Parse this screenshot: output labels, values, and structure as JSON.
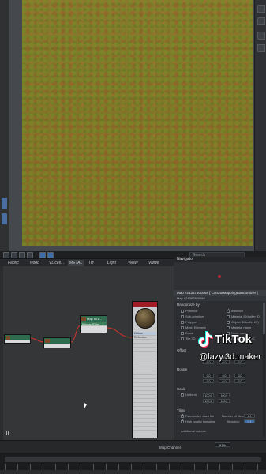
{
  "slate": {
    "search_placeholder": "Search",
    "tabs": [
      "Fabric",
      "wood",
      "VL ceil...",
      "METAL",
      "TH",
      "Light",
      "View7",
      "View8"
    ]
  },
  "nodes": {
    "n1": {
      "title": "",
      "rows": [
        "",
        ""
      ]
    },
    "n2": {
      "title": "",
      "rows": [
        "",
        ""
      ]
    },
    "n3": {
      "title": "Map #21...",
      "subtitle": "Bitmap/Filter",
      "rows": [
        "",
        ""
      ]
    },
    "material": {
      "title": "",
      "rows": [
        "Diffuse",
        "Reflection",
        "",
        "",
        "",
        "",
        "",
        "",
        "",
        "",
        "",
        "",
        "",
        "",
        "",
        "",
        "",
        "",
        "",
        "",
        "",
        "",
        "",
        "",
        "",
        "",
        "",
        ""
      ]
    }
  },
  "navigator": {
    "title": "Navigator"
  },
  "props": {
    "title": "Map #21387800068 [ CoronaMappingRandomizer ]",
    "subtitle": "Map #21387800068",
    "randomize_by": "Randomize by:",
    "left_opts": [
      "Primitive",
      "Sub-primitive",
      "Polygon",
      "Mesh Element",
      "Decal",
      "Tile 3D"
    ],
    "right_opts": [
      "Instance",
      "Material ID(buffer ID)",
      "Object ID(buffer ID)",
      "Material name",
      "Node name",
      "Face Material ID"
    ],
    "offset": "Offset",
    "rotate": "Rotate",
    "scale": "Scale",
    "uniform": "Uniform",
    "tiling": "Tiling",
    "randomize_each_tile": "Randomize each tile",
    "high_quality": "High quality blending",
    "additional": "Additional outputs",
    "number_of_tiles": "Number of tiles:",
    "blending": "Blending:",
    "tile_val": "1.0",
    "blend_val": "0.1",
    "field_vals": [
      "0.0",
      "0.0",
      "0.0",
      "0.0",
      "0.0",
      "0.0",
      "0.0",
      "0.0",
      "0.0",
      "0.0",
      "0.0",
      "0.0"
    ],
    "scale_vals": [
      "100.0",
      "100.0",
      "100.0",
      "100.0"
    ]
  },
  "overlay": {
    "brand": "TikTok",
    "handle": "@lazy.3d.maker"
  },
  "status": {
    "map_channel": "Map Channel",
    "zoom": "87%"
  },
  "colors": {
    "node_head": "#2d6b4f",
    "material_head": "#a01c24",
    "accent": "#3d6ea8",
    "wire": "#d0342c"
  }
}
